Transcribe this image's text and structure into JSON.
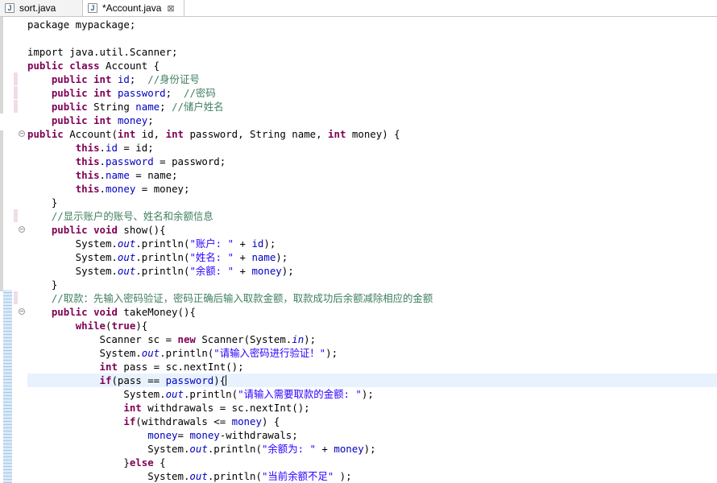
{
  "tabs": [
    {
      "label": "sort.java",
      "active": false
    },
    {
      "label": "*Account.java",
      "active": true,
      "close": "⊠"
    }
  ],
  "editor": {
    "current_line": 27,
    "lines": [
      [
        [
          "t",
          "package mypackage;"
        ]
      ],
      [],
      [
        [
          "t",
          "import java.util.Scanner;"
        ]
      ],
      [
        [
          "kw",
          "public"
        ],
        [
          "t",
          " "
        ],
        [
          "kw",
          "class"
        ],
        [
          "t",
          " Account {"
        ]
      ],
      [
        [
          "t",
          "    "
        ],
        [
          "kw",
          "public"
        ],
        [
          "t",
          " "
        ],
        [
          "kw",
          "int"
        ],
        [
          "t",
          " "
        ],
        [
          "fld",
          "id"
        ],
        [
          "t",
          ";  "
        ],
        [
          "cm",
          "//身份证号"
        ]
      ],
      [
        [
          "t",
          "    "
        ],
        [
          "kw",
          "public"
        ],
        [
          "t",
          " "
        ],
        [
          "kw",
          "int"
        ],
        [
          "t",
          " "
        ],
        [
          "fld",
          "password"
        ],
        [
          "t",
          ";  "
        ],
        [
          "cm",
          "//密码"
        ]
      ],
      [
        [
          "t",
          "    "
        ],
        [
          "kw",
          "public"
        ],
        [
          "t",
          " String "
        ],
        [
          "fld",
          "name"
        ],
        [
          "t",
          "; "
        ],
        [
          "cm",
          "//储户姓名"
        ]
      ],
      [
        [
          "t",
          "    "
        ],
        [
          "kw",
          "public"
        ],
        [
          "t",
          " "
        ],
        [
          "kw",
          "int"
        ],
        [
          "t",
          " "
        ],
        [
          "fld",
          "money"
        ],
        [
          "t",
          ";"
        ]
      ],
      [
        [
          "kw",
          "public"
        ],
        [
          "t",
          " Account("
        ],
        [
          "kw",
          "int"
        ],
        [
          "t",
          " id, "
        ],
        [
          "kw",
          "int"
        ],
        [
          "t",
          " password, String name, "
        ],
        [
          "kw",
          "int"
        ],
        [
          "t",
          " money) {"
        ]
      ],
      [
        [
          "t",
          "        "
        ],
        [
          "kw",
          "this"
        ],
        [
          "t",
          "."
        ],
        [
          "fld",
          "id"
        ],
        [
          "t",
          " = id;"
        ]
      ],
      [
        [
          "t",
          "        "
        ],
        [
          "kw",
          "this"
        ],
        [
          "t",
          "."
        ],
        [
          "fld",
          "password"
        ],
        [
          "t",
          " = password;"
        ]
      ],
      [
        [
          "t",
          "        "
        ],
        [
          "kw",
          "this"
        ],
        [
          "t",
          "."
        ],
        [
          "fld",
          "name"
        ],
        [
          "t",
          " = name;"
        ]
      ],
      [
        [
          "t",
          "        "
        ],
        [
          "kw",
          "this"
        ],
        [
          "t",
          "."
        ],
        [
          "fld",
          "money"
        ],
        [
          "t",
          " = money;"
        ]
      ],
      [
        [
          "t",
          "    }"
        ]
      ],
      [
        [
          "t",
          "    "
        ],
        [
          "cm",
          "//显示账户的账号、姓名和余额信息"
        ]
      ],
      [
        [
          "t",
          "    "
        ],
        [
          "kw",
          "public"
        ],
        [
          "t",
          " "
        ],
        [
          "kw",
          "void"
        ],
        [
          "t",
          " show(){"
        ]
      ],
      [
        [
          "t",
          "        System."
        ],
        [
          "st",
          "out"
        ],
        [
          "t",
          ".println("
        ],
        [
          "str",
          "\"账户: \""
        ],
        [
          "t",
          " + "
        ],
        [
          "fld",
          "id"
        ],
        [
          "t",
          ");"
        ]
      ],
      [
        [
          "t",
          "        System."
        ],
        [
          "st",
          "out"
        ],
        [
          "t",
          ".println("
        ],
        [
          "str",
          "\"姓名: \""
        ],
        [
          "t",
          " + "
        ],
        [
          "fld",
          "name"
        ],
        [
          "t",
          ");"
        ]
      ],
      [
        [
          "t",
          "        System."
        ],
        [
          "st",
          "out"
        ],
        [
          "t",
          ".println("
        ],
        [
          "str",
          "\"余额: \""
        ],
        [
          "t",
          " + "
        ],
        [
          "fld",
          "money"
        ],
        [
          "t",
          ");"
        ]
      ],
      [
        [
          "t",
          "    }"
        ]
      ],
      [
        [
          "t",
          "    "
        ],
        [
          "cm",
          "//取款：先输入密码验证，密码正确后输入取款金额，取款成功后余额减除相应的金额"
        ]
      ],
      [
        [
          "t",
          "    "
        ],
        [
          "kw",
          "public"
        ],
        [
          "t",
          " "
        ],
        [
          "kw",
          "void"
        ],
        [
          "t",
          " takeMoney(){"
        ]
      ],
      [
        [
          "t",
          "        "
        ],
        [
          "kw",
          "while"
        ],
        [
          "t",
          "("
        ],
        [
          "kw",
          "true"
        ],
        [
          "t",
          "){"
        ]
      ],
      [
        [
          "t",
          "            Scanner sc = "
        ],
        [
          "kw",
          "new"
        ],
        [
          "t",
          " Scanner(System."
        ],
        [
          "st",
          "in"
        ],
        [
          "t",
          ");"
        ]
      ],
      [
        [
          "t",
          "            System."
        ],
        [
          "st",
          "out"
        ],
        [
          "t",
          ".println("
        ],
        [
          "str",
          "\"请输入密码进行验证！\""
        ],
        [
          "t",
          ");"
        ]
      ],
      [
        [
          "t",
          "            "
        ],
        [
          "kw",
          "int"
        ],
        [
          "t",
          " pass = sc.nextInt();"
        ]
      ],
      [
        [
          "t",
          "            "
        ],
        [
          "kw",
          "if"
        ],
        [
          "t",
          "(pass == "
        ],
        [
          "fld",
          "password"
        ],
        [
          "t",
          "){"
        ]
      ],
      [
        [
          "t",
          "                System."
        ],
        [
          "st",
          "out"
        ],
        [
          "t",
          ".println("
        ],
        [
          "str",
          "\"请输入需要取款的金额: \""
        ],
        [
          "t",
          ");"
        ]
      ],
      [
        [
          "t",
          "                "
        ],
        [
          "kw",
          "int"
        ],
        [
          "t",
          " withdrawals = sc.nextInt();"
        ]
      ],
      [
        [
          "t",
          "                "
        ],
        [
          "kw",
          "if"
        ],
        [
          "t",
          "(withdrawals <= "
        ],
        [
          "fld",
          "money"
        ],
        [
          "t",
          ") {"
        ]
      ],
      [
        [
          "t",
          "                    "
        ],
        [
          "fld",
          "money"
        ],
        [
          "t",
          "= "
        ],
        [
          "fld",
          "money"
        ],
        [
          "t",
          "-withdrawals;"
        ]
      ],
      [
        [
          "t",
          "                    System."
        ],
        [
          "st",
          "out"
        ],
        [
          "t",
          ".println("
        ],
        [
          "str",
          "\"余额为: \""
        ],
        [
          "t",
          " + "
        ],
        [
          "fld",
          "money"
        ],
        [
          "t",
          ");"
        ]
      ],
      [
        [
          "t",
          "                }"
        ],
        [
          "kw",
          "else"
        ],
        [
          "t",
          " {"
        ]
      ],
      [
        [
          "t",
          "                    System."
        ],
        [
          "st",
          "out"
        ],
        [
          "t",
          ".println("
        ],
        [
          "str",
          "\"当前余额不足\""
        ],
        [
          "t",
          " );"
        ]
      ]
    ]
  },
  "gutter": {
    "fold_lines": [
      9,
      16,
      22
    ],
    "fold_glyph": "⊖",
    "diff_marker_lines": [
      5,
      6,
      7,
      15,
      21
    ]
  }
}
